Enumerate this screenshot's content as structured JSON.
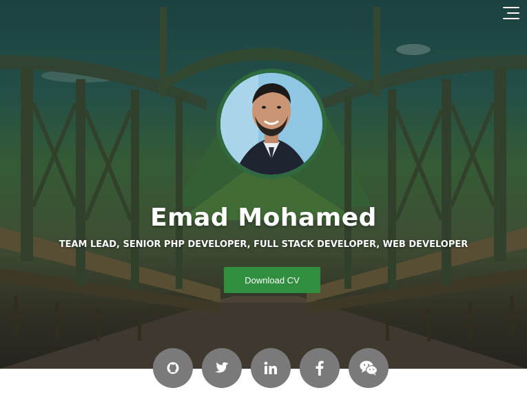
{
  "header": {
    "menu_icon": "hamburger-menu-icon"
  },
  "profile": {
    "name": "Emad Mohamed",
    "subtitle": "TEAM LEAD, SENIOR PHP DEVELOPER, FULL STACK DEVELOPER, WEB DEVELOPER",
    "cv_button_label": "Download CV",
    "avatar_icon": "profile-photo"
  },
  "social": [
    {
      "icon": "github-icon"
    },
    {
      "icon": "twitter-icon"
    },
    {
      "icon": "linkedin-icon"
    },
    {
      "icon": "facebook-icon"
    },
    {
      "icon": "wechat-icon"
    }
  ],
  "colors": {
    "accent": "#2f8f3f",
    "avatar_ring": "#2f6a3e",
    "social_bg": "#7a7a7a",
    "text": "#ffffff"
  }
}
